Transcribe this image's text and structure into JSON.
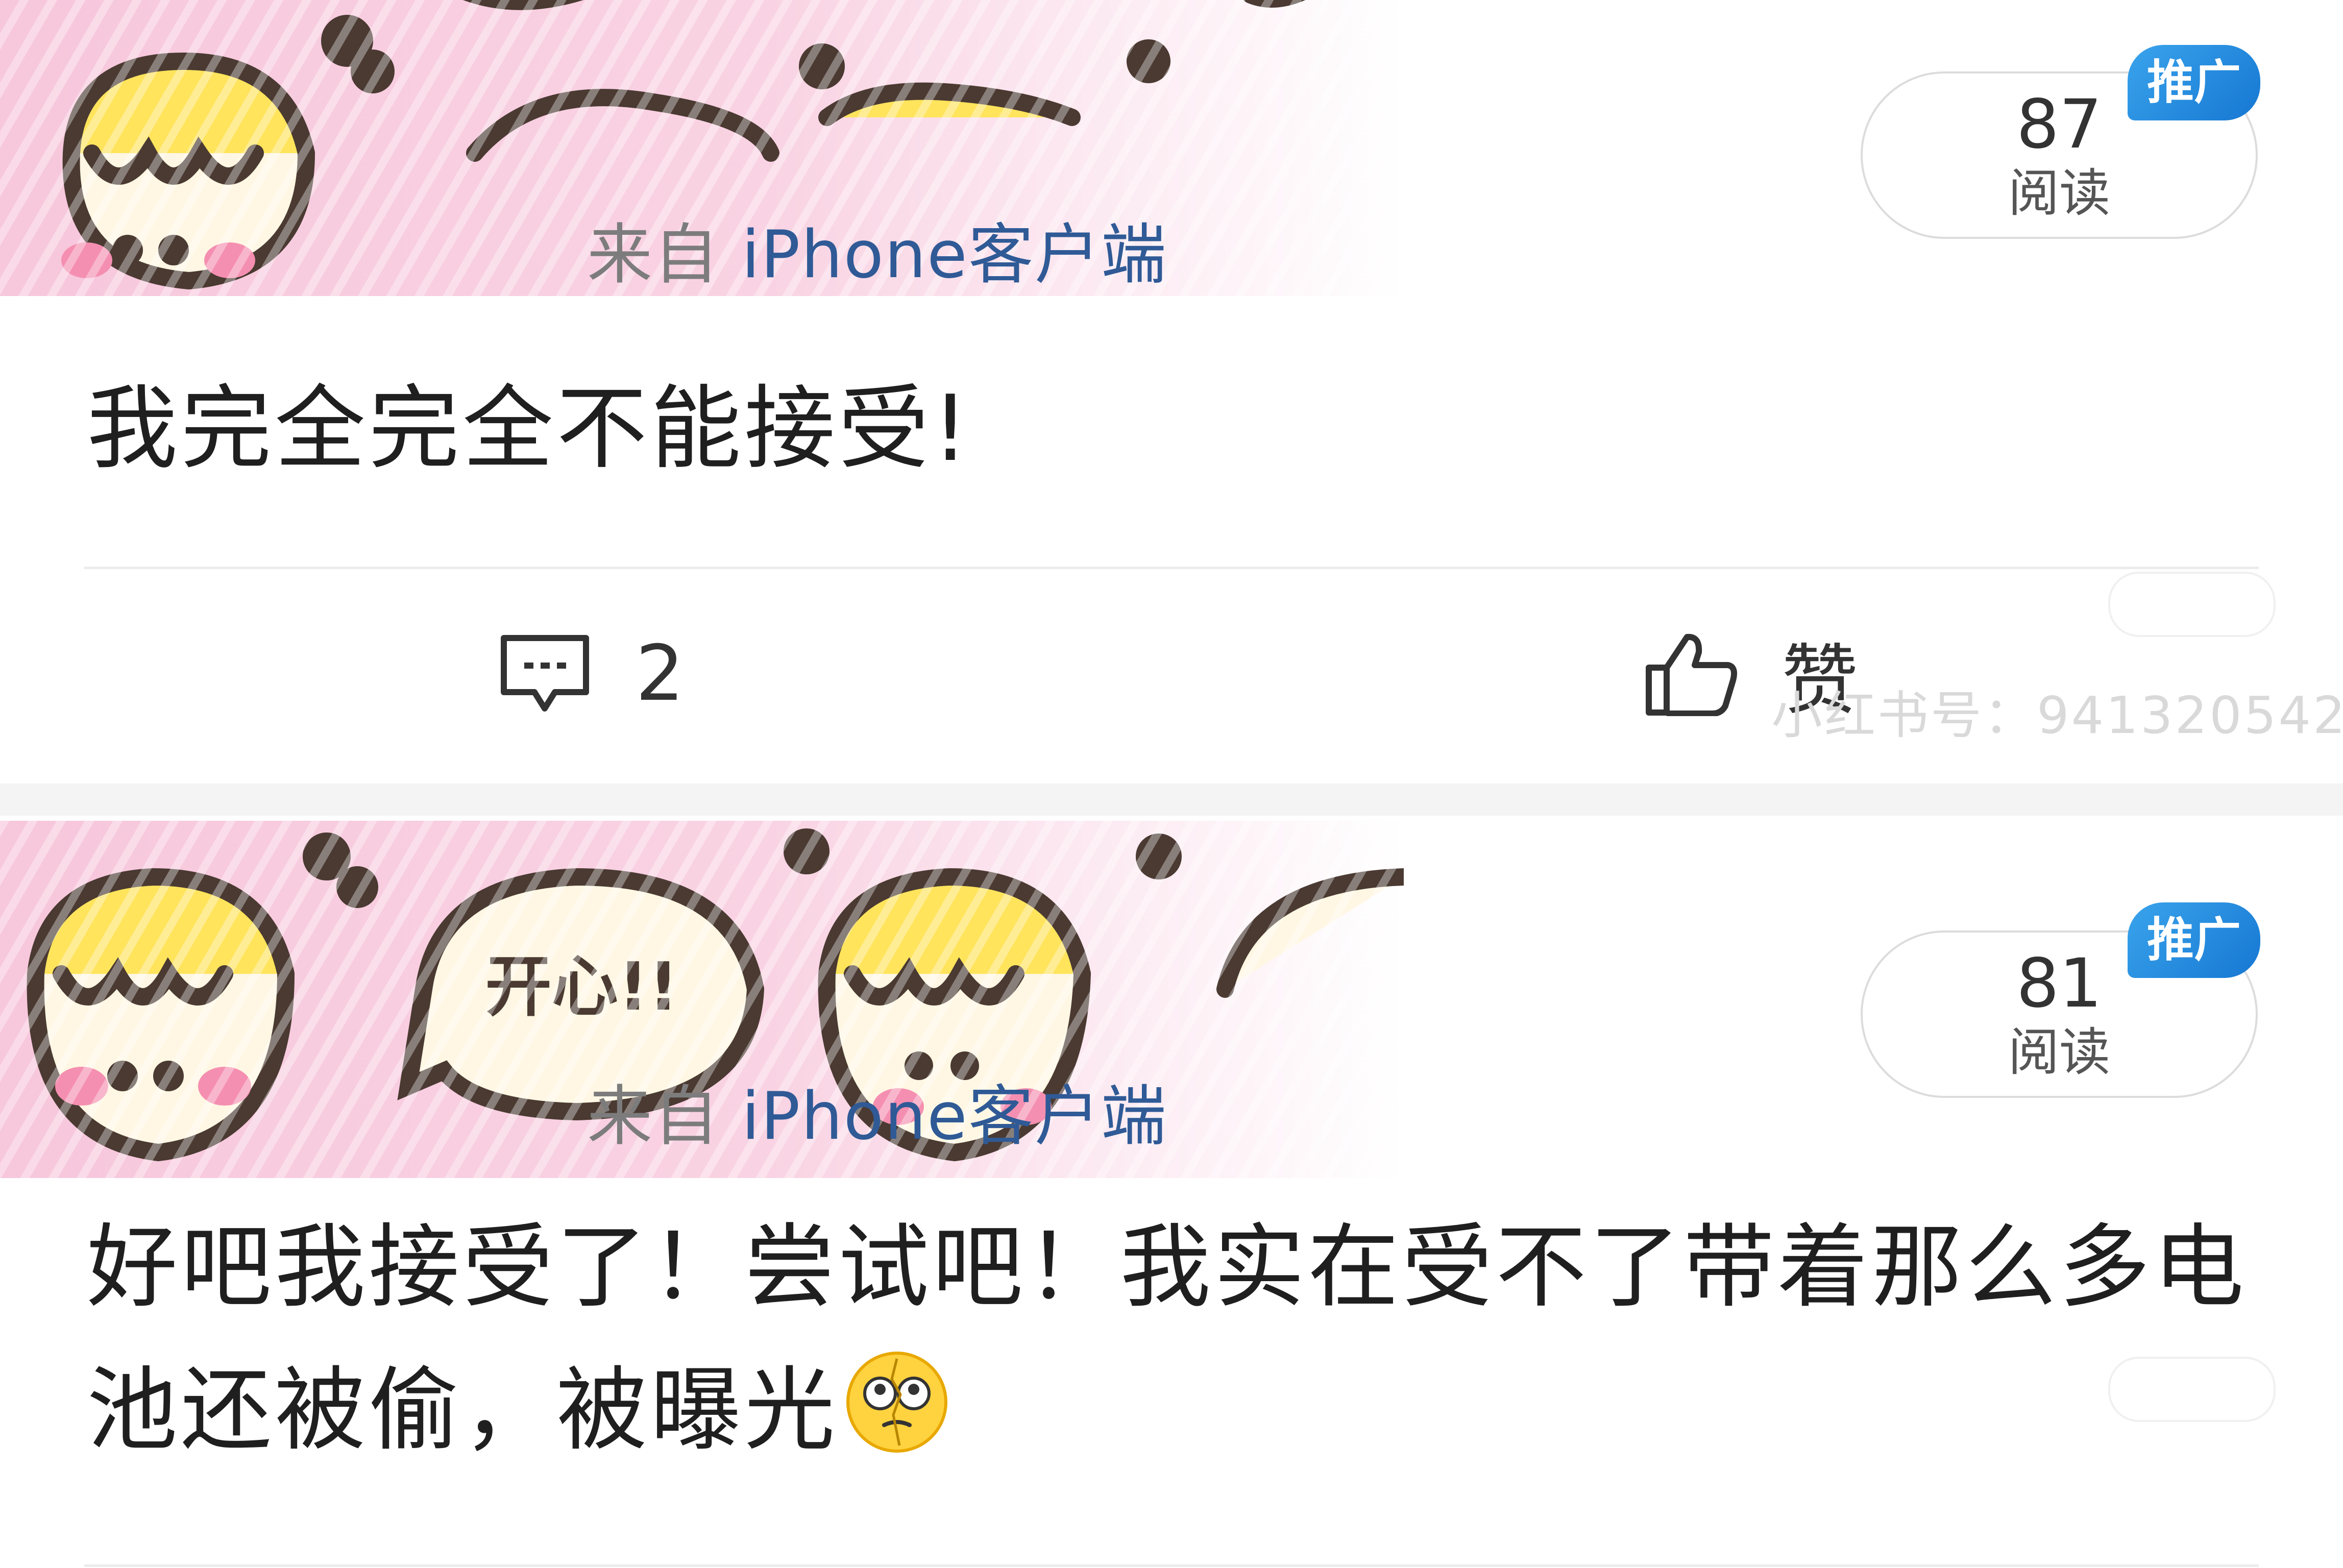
{
  "posts": [
    {
      "source_prefix": "来自",
      "source_device": "iPhone客户端",
      "read_count": "87",
      "read_label": "阅读",
      "promo_badge": "推广",
      "text": "我完全完全不能接受!",
      "comment_count": "2",
      "like_label": "赞",
      "watermark": "小红书号：941320542"
    },
    {
      "source_prefix": "来自",
      "source_device": "iPhone客户端",
      "read_count": "81",
      "read_label": "阅读",
      "promo_badge": "推广",
      "text": "好吧我接受了！尝试吧！我实在受不了带着那么多电池还被偷，被曝光",
      "sticker_text": "开心!!"
    }
  ],
  "colors": {
    "link_blue": "#2f5a96",
    "badge_blue": "#1677d2",
    "sticker_pink": "#f7c7dc",
    "sticker_yellow": "#ffe45c",
    "sticker_outline": "#4a3a32"
  },
  "icons": {
    "comment": "comment-bubble-icon",
    "like": "thumbs-up-icon",
    "emoji": "dizzy-face-emoji"
  }
}
